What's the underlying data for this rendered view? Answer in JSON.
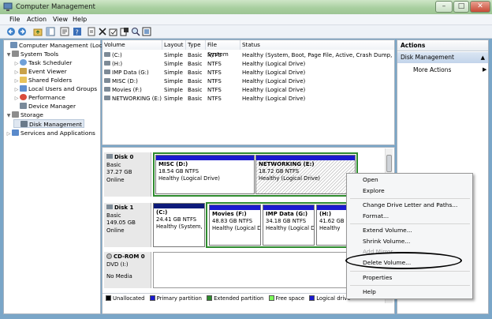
{
  "window": {
    "title": "Computer Management"
  },
  "menu": [
    "File",
    "Action",
    "View",
    "Help"
  ],
  "tree": [
    {
      "label": "Computer Management (Local)",
      "level": 0,
      "expander": "",
      "icon": "computer-icon",
      "color": "#6d8fb5"
    },
    {
      "label": "System Tools",
      "level": 1,
      "expander": "▼",
      "icon": "tools-icon",
      "color": "#8d8d8d"
    },
    {
      "label": "Task Scheduler",
      "level": 2,
      "expander": "▷",
      "icon": "clock-icon",
      "color": "#6fa0d8"
    },
    {
      "label": "Event Viewer",
      "level": 2,
      "expander": "▷",
      "icon": "event-viewer-icon",
      "color": "#c9a24a"
    },
    {
      "label": "Shared Folders",
      "level": 2,
      "expander": "▷",
      "icon": "folder-icon",
      "color": "#e8c35a"
    },
    {
      "label": "Local Users and Groups",
      "level": 2,
      "expander": "▷",
      "icon": "users-icon",
      "color": "#5f8fcf"
    },
    {
      "label": "Performance",
      "level": 2,
      "expander": "▷",
      "icon": "performance-icon",
      "color": "#d94c3c"
    },
    {
      "label": "Device Manager",
      "level": 2,
      "expander": "",
      "icon": "device-manager-icon",
      "color": "#7a8a9a"
    },
    {
      "label": "Storage",
      "level": 1,
      "expander": "▼",
      "icon": "storage-icon",
      "color": "#8d8d8d"
    },
    {
      "label": "Disk Management",
      "level": 2,
      "expander": "",
      "icon": "disk-icon",
      "color": "#6a7a8a",
      "selected": true
    },
    {
      "label": "Services and Applications",
      "level": 1,
      "expander": "▷",
      "icon": "services-icon",
      "color": "#5a8acb"
    }
  ],
  "volumes": {
    "headers": [
      "Volume",
      "Layout",
      "Type",
      "File System",
      "Status"
    ],
    "rows": [
      [
        "(C:)",
        "Simple",
        "Basic",
        "NTFS",
        "Healthy (System, Boot, Page File, Active, Crash Dump, Prim"
      ],
      [
        "(H:)",
        "Simple",
        "Basic",
        "NTFS",
        "Healthy (Logical Drive)"
      ],
      [
        "IMP Data (G:)",
        "Simple",
        "Basic",
        "NTFS",
        "Healthy (Logical Drive)"
      ],
      [
        "MISC (D:)",
        "Simple",
        "Basic",
        "NTFS",
        "Healthy (Logical Drive)"
      ],
      [
        "Movies (F:)",
        "Simple",
        "Basic",
        "NTFS",
        "Healthy (Logical Drive)"
      ],
      [
        "NETWORKING (E:)",
        "Simple",
        "Basic",
        "NTFS",
        "Healthy (Logical Drive)"
      ]
    ]
  },
  "disks": [
    {
      "name": "Disk 0",
      "type": "Basic",
      "size": "37.27 GB",
      "state": "Online",
      "partitions": [
        {
          "name": "MISC  (D:)",
          "size": "18.54 GB NTFS",
          "status": "Healthy (Logical Drive)"
        },
        {
          "name": "NETWORKING  (E:)",
          "size": "18.72 GB NTFS",
          "status": "Healthy (Logical Drive)"
        }
      ]
    },
    {
      "name": "Disk 1",
      "type": "Basic",
      "size": "149.05 GB",
      "state": "Online",
      "partitions": [
        {
          "name": "(C:)",
          "size": "24.41 GB NTFS",
          "status": "Healthy (System,"
        },
        {
          "name": "Movies  (F:)",
          "size": "48.83 GB NTFS",
          "status": "Healthy (Logical D"
        },
        {
          "name": "IMP Data  (G:)",
          "size": "34.18 GB NTFS",
          "status": "Healthy (Logical D"
        },
        {
          "name": "(H:)",
          "size": "41.62 GB",
          "status": "Healthy"
        }
      ]
    },
    {
      "name": "CD-ROM 0",
      "type": "DVD (I:)",
      "size": "",
      "state": "No Media",
      "partitions": []
    }
  ],
  "legend": [
    {
      "label": "Unallocated",
      "color": "#000000"
    },
    {
      "label": "Primary partition",
      "color": "#1a1ad0"
    },
    {
      "label": "Extended partition",
      "color": "#2e8b2e"
    },
    {
      "label": "Free space",
      "color": "#7cfc5a"
    },
    {
      "label": "Logical drive",
      "color": "#1a1ad0"
    }
  ],
  "actions": {
    "header": "Actions",
    "section": "Disk Management",
    "more": "More Actions"
  },
  "context_menu": [
    {
      "label": "Open",
      "enabled": true
    },
    {
      "label": "Explore",
      "enabled": true
    },
    {
      "label": "Change Drive Letter and Paths...",
      "enabled": true
    },
    {
      "label": "Format...",
      "enabled": true
    },
    {
      "label": "Extend Volume...",
      "enabled": true
    },
    {
      "label": "Shrink Volume...",
      "enabled": true
    },
    {
      "label": "Add Mirror...",
      "enabled": false
    },
    {
      "label": "Delete Volume...",
      "enabled": true
    },
    {
      "label": "Properties",
      "enabled": true
    },
    {
      "label": "Help",
      "enabled": true
    }
  ],
  "colors": {
    "primary": "#1a1ad0",
    "extended": "#2e8b2e",
    "selection": "#dfe7f1"
  }
}
